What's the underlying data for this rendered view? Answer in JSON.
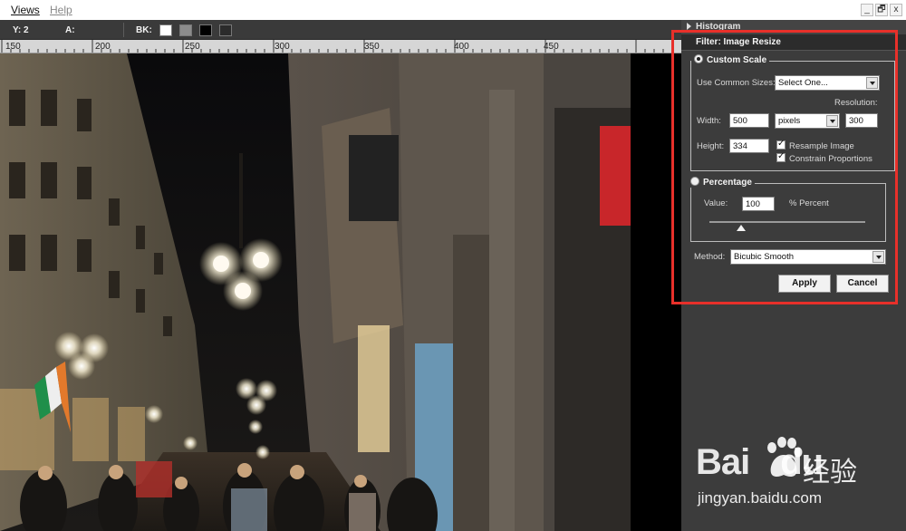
{
  "menubar": {
    "items": [
      {
        "label": "Views",
        "mnemonic": "V"
      },
      {
        "label": "Help",
        "mnemonic": "H"
      }
    ],
    "window_controls": [
      "_",
      "🗗",
      "x"
    ]
  },
  "infobar": {
    "y_label": "Y:",
    "y_value": "2",
    "a_label": "A:",
    "bk_label": "BK:",
    "swatches": [
      "#ffffff",
      "#8c8c8c",
      "#000000",
      "#2b2b2b"
    ]
  },
  "ruler": {
    "ticks": [
      "150",
      "200",
      "250",
      "300",
      "350",
      "400",
      "450"
    ]
  },
  "panel": {
    "histogram_title": "Histogram",
    "filter_title": "Filter: Image Resize",
    "custom_scale": {
      "title": "Custom Scale",
      "selected": true,
      "common_sizes_label": "Use Common Sizes:",
      "common_sizes_value": "Select One...",
      "resolution_label": "Resolution:",
      "width_label": "Width:",
      "width_value": "500",
      "unit_value": "pixels",
      "resolution_value": "300",
      "height_label": "Height:",
      "height_value": "334",
      "resample_label": "Resample Image",
      "resample_checked": true,
      "constrain_label": "Constrain Proportions",
      "constrain_checked": true
    },
    "percentage": {
      "title": "Percentage",
      "selected": false,
      "value_label": "Value:",
      "value": "100",
      "unit_label": "% Percent"
    },
    "method_label": "Method:",
    "method_value": "Bicubic Smooth",
    "apply_label": "Apply",
    "cancel_label": "Cancel"
  },
  "watermark": {
    "brand": "Bai",
    "brand_tail": "du",
    "cn": "经验",
    "url": "jingyan.baidu.com"
  },
  "colors": {
    "panel_bg": "#3c3c3c",
    "highlight": "#e8302a"
  }
}
